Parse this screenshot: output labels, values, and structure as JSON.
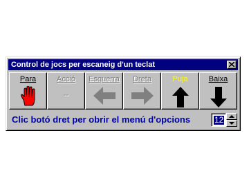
{
  "window": {
    "title": "Control de jocs per escaneig d'un teclat"
  },
  "toolbar": {
    "buttons": [
      {
        "label": "Para",
        "icon": "red-hand-stop-icon",
        "state": "enabled"
      },
      {
        "label": "Acció",
        "extra": "--",
        "icon": "none",
        "state": "disabled"
      },
      {
        "label": "Esquerra",
        "icon": "left-arrow-icon",
        "state": "disabled"
      },
      {
        "label": "Dreta",
        "icon": "right-arrow-icon",
        "state": "disabled"
      },
      {
        "label": "Puja",
        "icon": "up-arrow-icon",
        "state": "highlight"
      },
      {
        "label": "Baixa",
        "icon": "down-arrow-icon",
        "state": "enabled"
      }
    ]
  },
  "status": {
    "hint": "Clic botó dret per obrir el menú d'opcions"
  },
  "spinner": {
    "value": "12"
  },
  "colors": {
    "titlebar": "#000080",
    "hint_text": "#0000aa",
    "highlight_label": "#ffff00",
    "hand": "#ff0000"
  }
}
